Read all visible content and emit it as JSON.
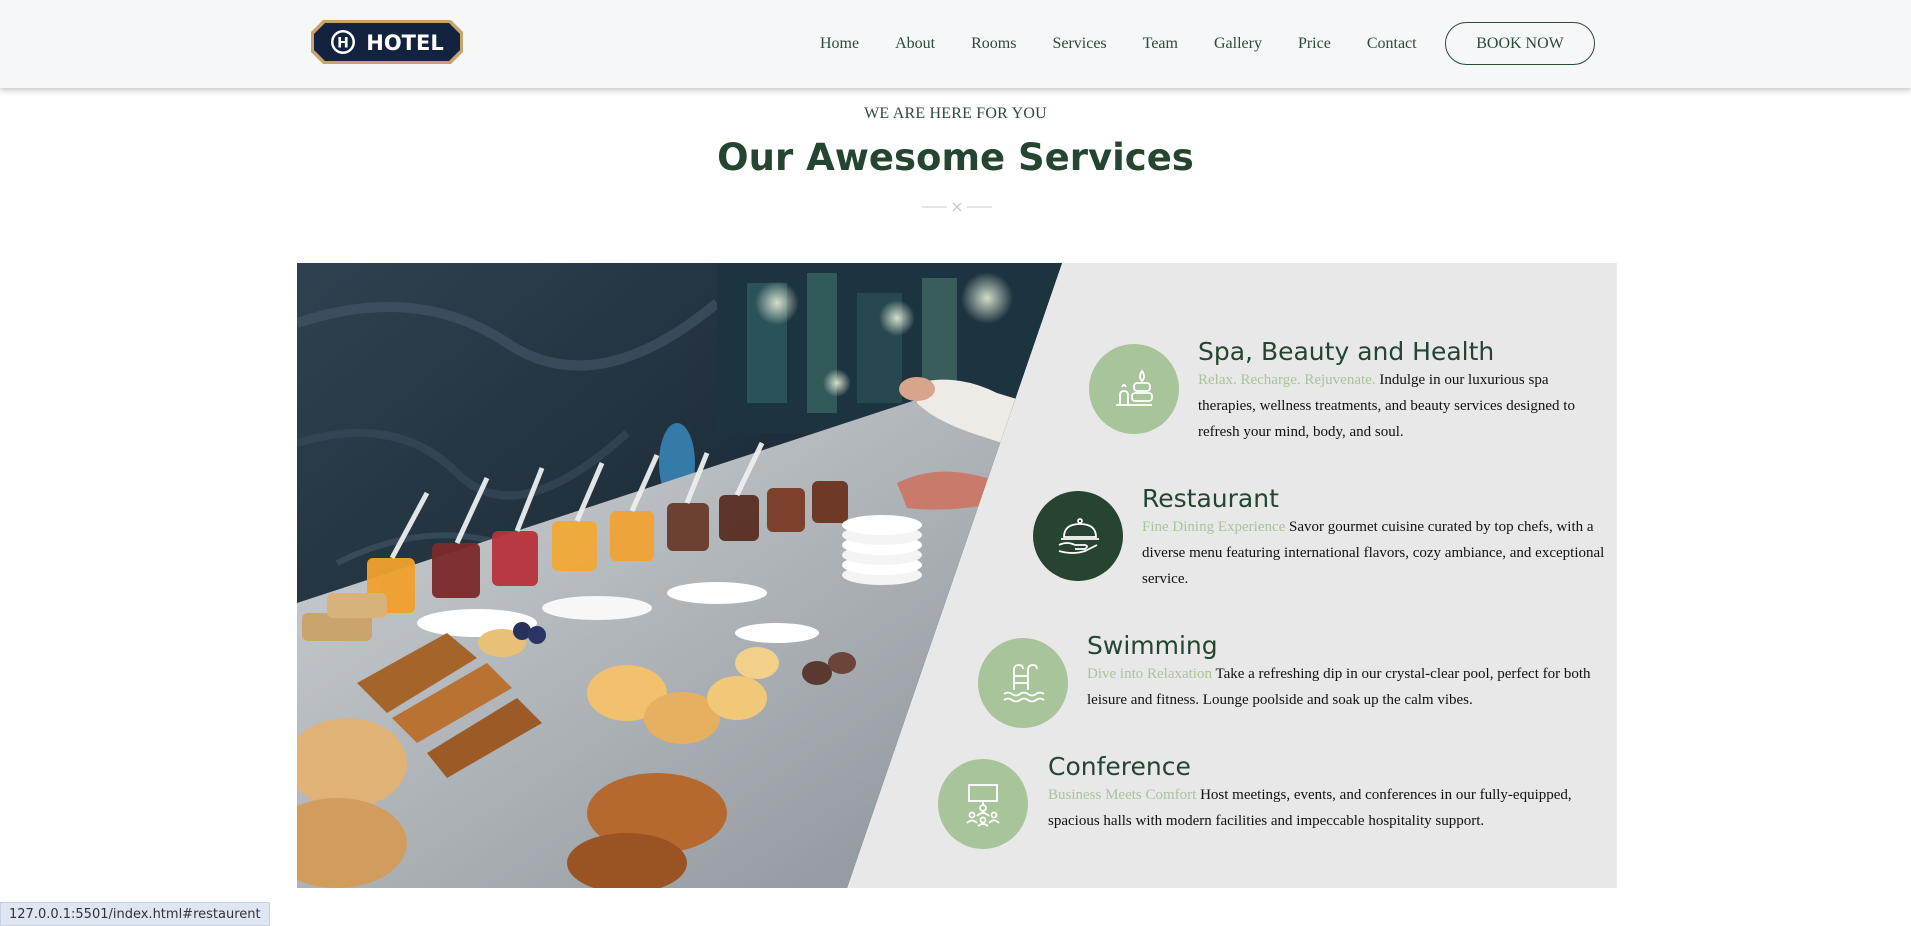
{
  "header": {
    "logo_text": "HOTEL",
    "nav": [
      "Home",
      "About",
      "Rooms",
      "Services",
      "Team",
      "Gallery",
      "Price",
      "Contact"
    ],
    "book_label": "BOOK NOW"
  },
  "section": {
    "kicker": "WE ARE HERE FOR YOU",
    "title": "Our Awesome Services"
  },
  "services": [
    {
      "title": "Spa, Beauty and Health",
      "tag": "Relax. Recharge. Rejuvenate.",
      "text": "Indulge in our luxurious spa therapies, wellness treatments, and beauty services designed to refresh your mind, body, and soul.",
      "icon": "spa-stones-icon"
    },
    {
      "title": "Restaurant",
      "tag": "Fine Dining Experience",
      "text": "Savor gourmet cuisine curated by top chefs, with a diverse menu featuring international flavors, cozy ambiance, and exceptional service.",
      "icon": "cloche-icon"
    },
    {
      "title": "Swimming",
      "tag": "Dive into Relaxation",
      "text": "Take a refreshing dip in our crystal-clear pool, perfect for both leisure and fitness. Lounge poolside and soak up the calm vibes.",
      "icon": "pool-ladder-icon"
    },
    {
      "title": "Conference",
      "tag": "Business Meets Comfort",
      "text": "Host meetings, events, and conferences in our fully-equipped, spacious halls with modern facilities and impeccable hospitality support.",
      "icon": "presentation-icon"
    }
  ],
  "status_bar": {
    "url": "127.0.0.1:5501/index.html#restaurent"
  },
  "colors": {
    "accent_green": "#a8c49a",
    "dark_green": "#264430",
    "panel_gray": "#e8e8e8"
  }
}
